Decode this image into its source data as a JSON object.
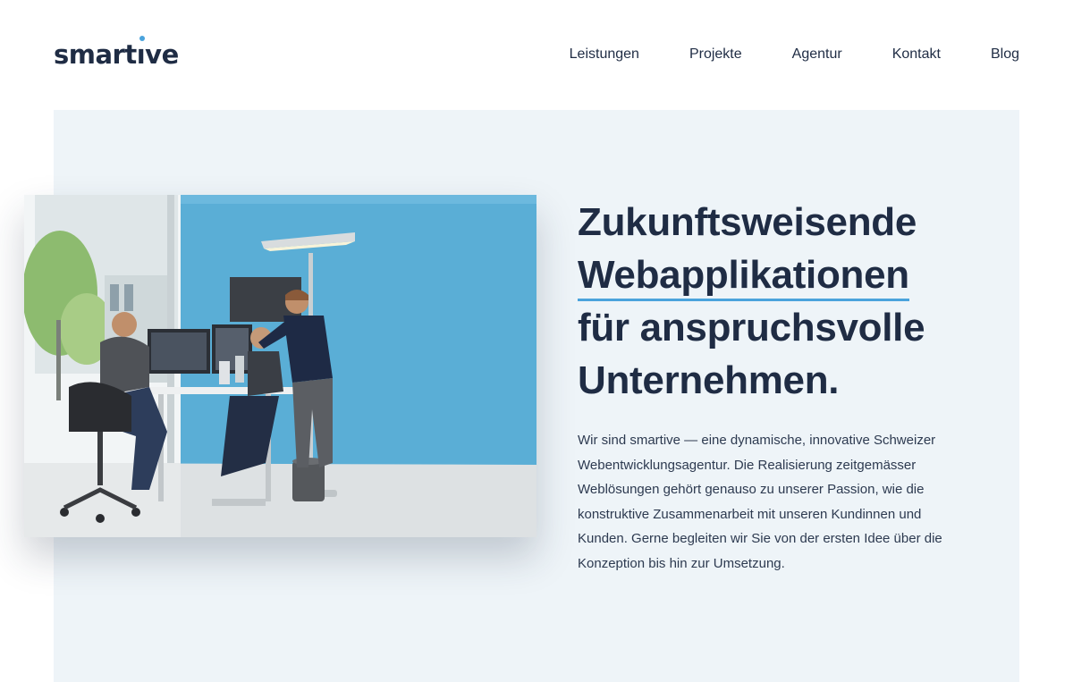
{
  "header": {
    "logo_text_pre": "smart",
    "logo_text_tick": "ı",
    "logo_text_post": "ve",
    "nav": [
      {
        "label": "Leistungen"
      },
      {
        "label": "Projekte"
      },
      {
        "label": "Agentur"
      },
      {
        "label": "Kontakt"
      },
      {
        "label": "Blog"
      }
    ]
  },
  "hero": {
    "heading_lines": [
      "Zukunftsweisende",
      "Webapplikationen",
      "für anspruchsvolle",
      "Unternehmen."
    ],
    "description": "Wir sind smartive — eine dynamische, innovative Schweizer Webentwicklungsagentur. Die Realisierung zeitgemässer Weblösungen gehört genauso zu unserer Passion, wie die konstruktive Zusammenarbeit mit unseren Kundinnen und Kunden. Gerne begleiten wir Sie von der ersten Idee über die Konzeption bis hin zur Umsetzung.",
    "image_icon": "office-photo"
  },
  "colors": {
    "brand_dark": "#1f2c44",
    "accent_blue": "#4aa3dc",
    "hero_bg": "#eef4f8",
    "wall_blue": "#5aaed6"
  }
}
